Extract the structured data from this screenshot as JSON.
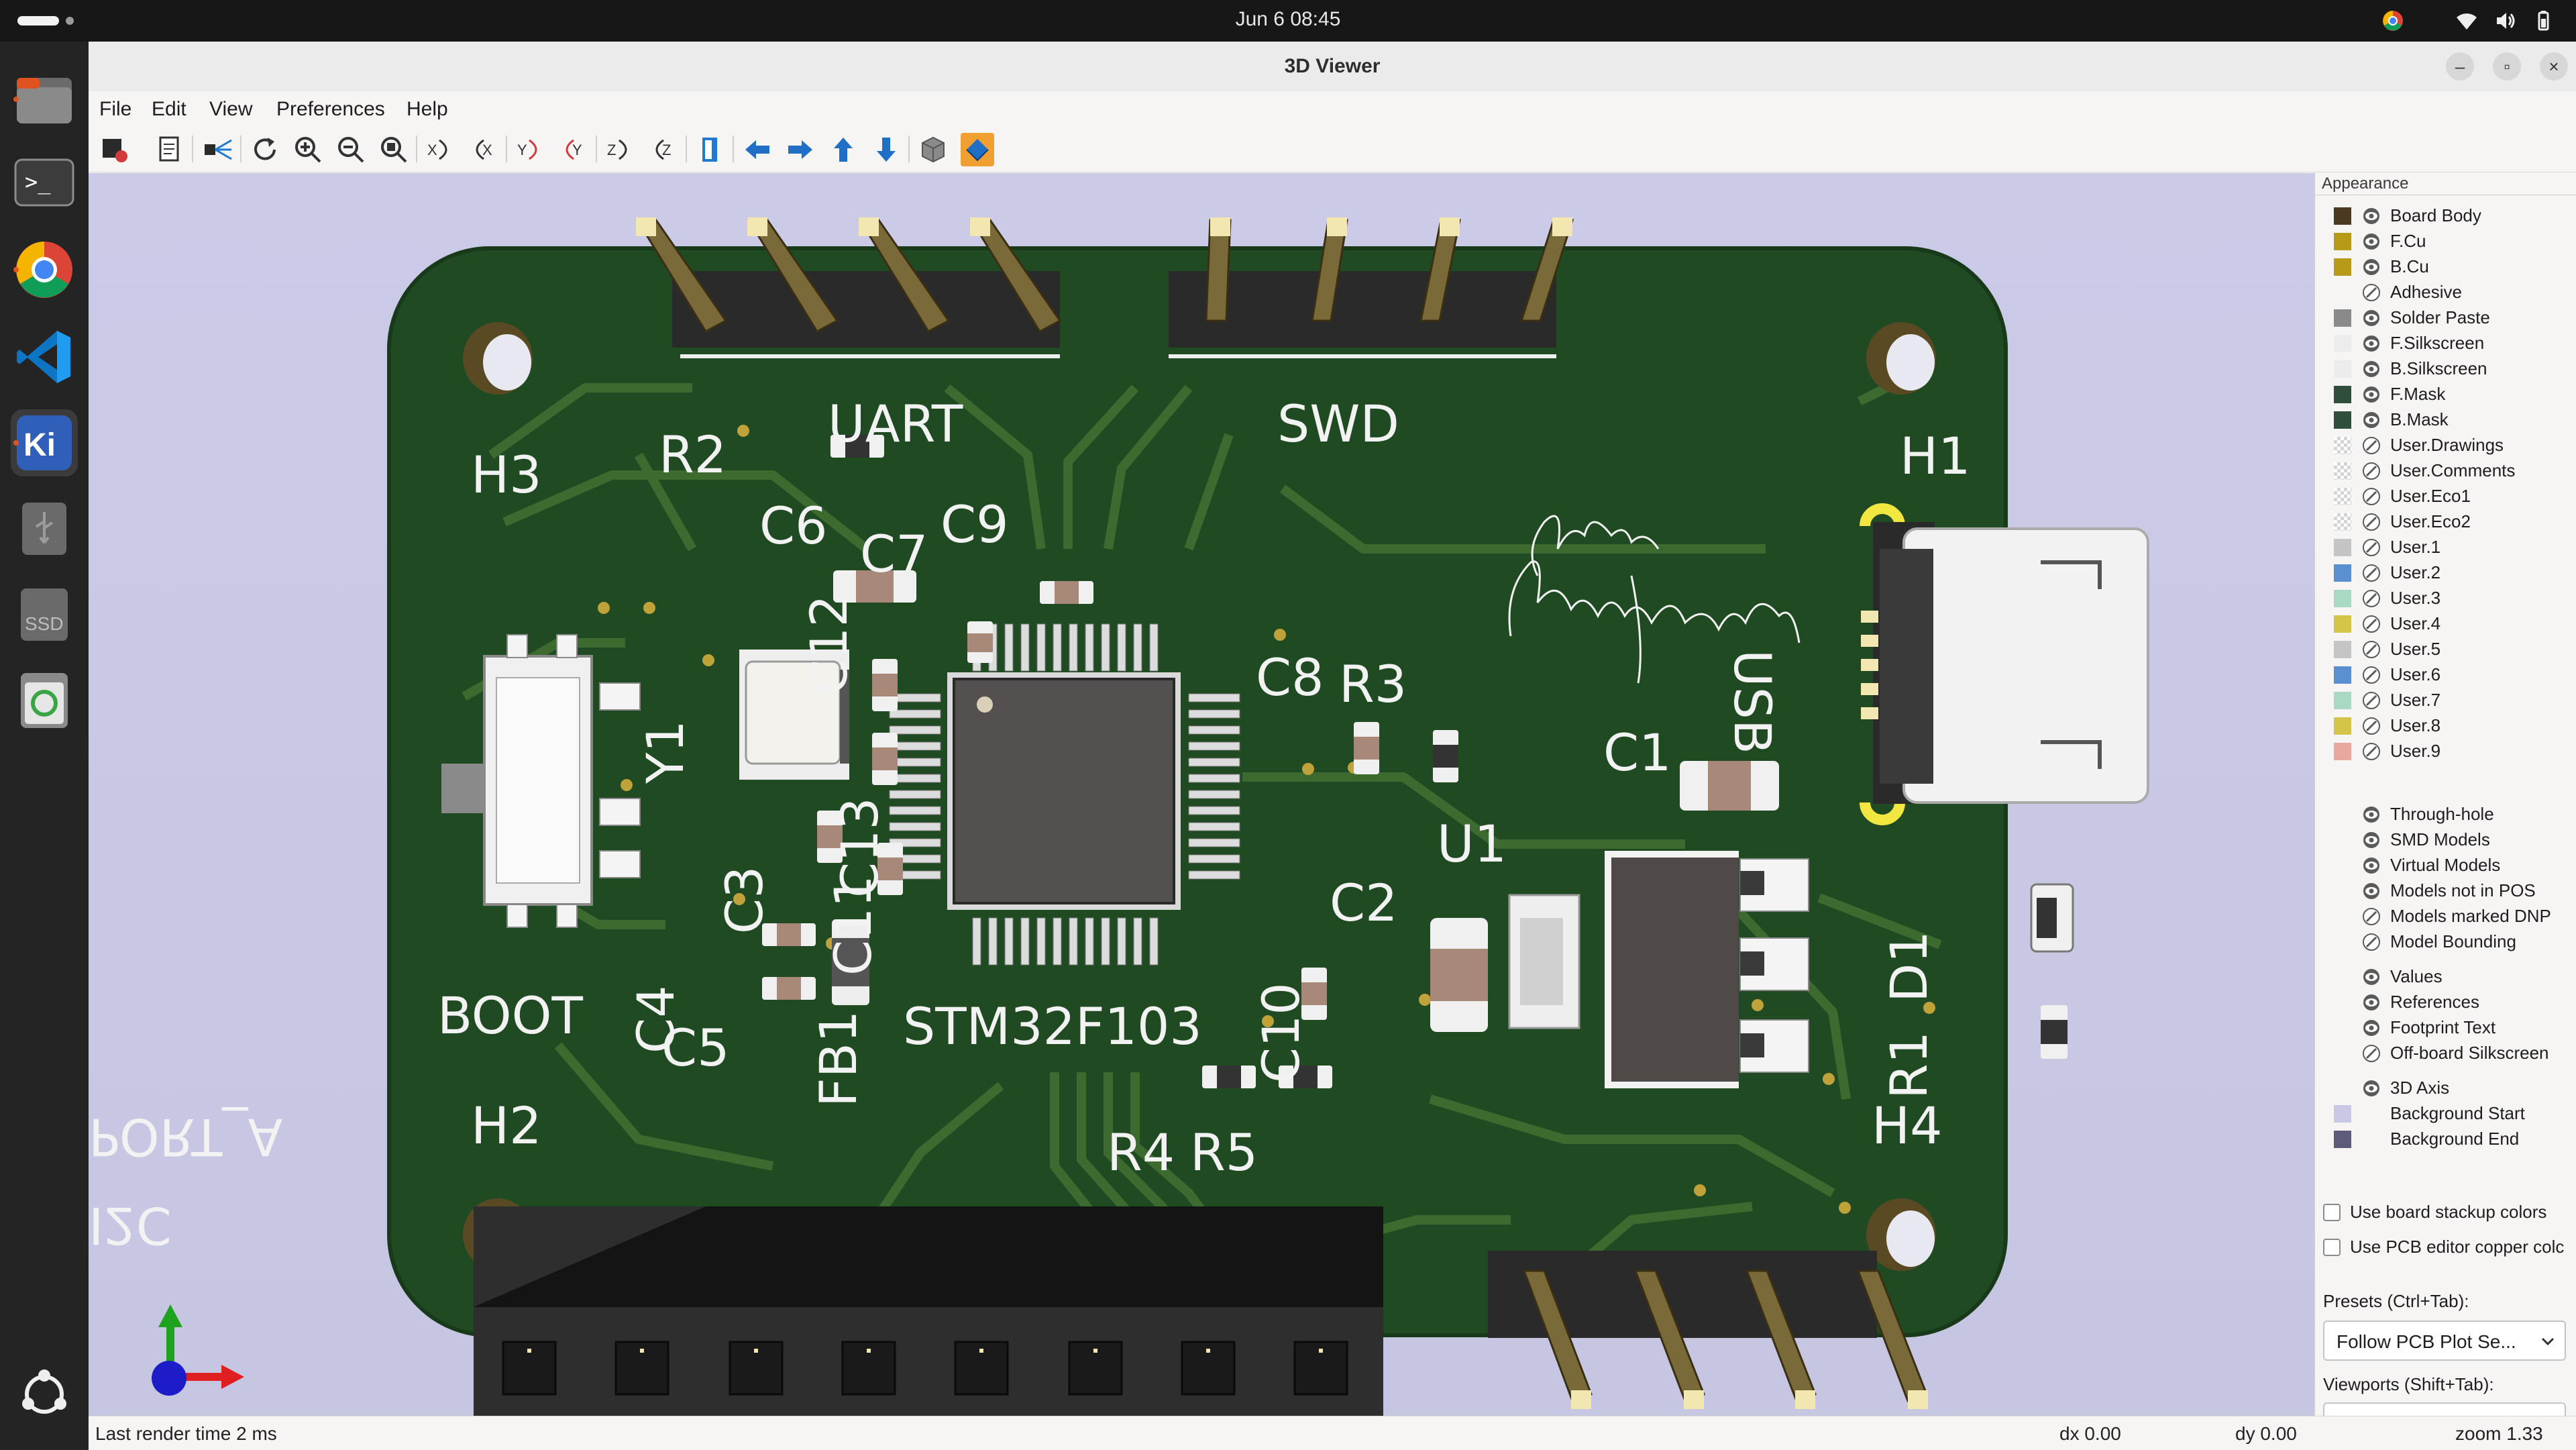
{
  "system": {
    "clock": "Jun 6  08:45"
  },
  "dock": {
    "items": [
      {
        "name": "Files",
        "icon": "folder-icon"
      },
      {
        "name": "Terminal",
        "icon": "terminal-icon"
      },
      {
        "name": "Google Chrome",
        "icon": "chrome-icon"
      },
      {
        "name": "Visual Studio Code",
        "icon": "vscode-icon"
      },
      {
        "name": "KiCad",
        "icon": "kicad-icon",
        "label": "Ki"
      },
      {
        "name": "USB Drive",
        "icon": "usb-icon"
      },
      {
        "name": "SSD",
        "icon": "drive-icon",
        "label": "SSD"
      },
      {
        "name": "Trash",
        "icon": "trash-icon"
      },
      {
        "name": "Show Apps",
        "icon": "ubuntu-icon"
      }
    ]
  },
  "window": {
    "title": "3D Viewer"
  },
  "menubar": [
    "File",
    "Edit",
    "View",
    "Preferences",
    "Help"
  ],
  "board": {
    "labels": {
      "uart": "UART",
      "swd": "SWD",
      "h1": "H1",
      "h2": "H2",
      "h3": "H3",
      "h4": "H4",
      "r1": "R1",
      "r2": "R2",
      "r3": "R3",
      "r4": "R4",
      "r5": "R5",
      "c1": "C1",
      "c2": "C2",
      "c3": "C3",
      "c4": "C4",
      "c5": "C5",
      "c6": "C6",
      "c7": "C7",
      "c8": "C8",
      "c9": "C9",
      "c10": "C10",
      "c11": "C11",
      "c12": "C12",
      "c13": "C13",
      "y1": "Y1",
      "fb1": "FB1",
      "u1": "U1",
      "d1": "D1",
      "usb": "USB",
      "boot": "BOOT",
      "mcu": "STM32F103",
      "porta": "PORT_A",
      "i2c": "I2C"
    },
    "colors": {
      "soldermask": "#1f4a22",
      "trace": "#3d6a2e",
      "silkscreen": "#f2f2f2",
      "background": "#c9cae6"
    }
  },
  "appearance": {
    "title": "Appearance",
    "layers": [
      {
        "name": "Board Body",
        "color": "#4a3a22",
        "visible": true
      },
      {
        "name": "F.Cu",
        "color": "#b89a1a",
        "visible": true
      },
      {
        "name": "B.Cu",
        "color": "#b89a1a",
        "visible": true
      },
      {
        "name": "Adhesive",
        "color": "",
        "visible": false
      },
      {
        "name": "Solder Paste",
        "color": "#8a8a8a",
        "visible": true
      },
      {
        "name": "F.Silkscreen",
        "color": "#ececec",
        "visible": true
      },
      {
        "name": "B.Silkscreen",
        "color": "#ececec",
        "visible": true
      },
      {
        "name": "F.Mask",
        "color": "#2f4f3a",
        "visible": true
      },
      {
        "name": "B.Mask",
        "color": "#2f4f3a",
        "visible": true
      },
      {
        "name": "User.Drawings",
        "color": "#e6e6e6",
        "visible": false
      },
      {
        "name": "User.Comments",
        "color": "#e6e6e6",
        "visible": false
      },
      {
        "name": "User.Eco1",
        "color": "#e6e6e6",
        "visible": false
      },
      {
        "name": "User.Eco2",
        "color": "#e6e6e6",
        "visible": false
      },
      {
        "name": "User.1",
        "color": "#c4c4c4",
        "visible": false
      },
      {
        "name": "User.2",
        "color": "#5a8fd0",
        "visible": false
      },
      {
        "name": "User.3",
        "color": "#a9d8c3",
        "visible": false
      },
      {
        "name": "User.4",
        "color": "#d4c44a",
        "visible": false
      },
      {
        "name": "User.5",
        "color": "#c4c4c4",
        "visible": false
      },
      {
        "name": "User.6",
        "color": "#5a8fd0",
        "visible": false
      },
      {
        "name": "User.7",
        "color": "#a9d8c3",
        "visible": false
      },
      {
        "name": "User.8",
        "color": "#d4c44a",
        "visible": false
      },
      {
        "name": "User.9",
        "color": "#e8a8a0",
        "visible": false
      }
    ],
    "objects": [
      {
        "name": "Through-hole",
        "visible": true
      },
      {
        "name": "SMD Models",
        "visible": true
      },
      {
        "name": "Virtual Models",
        "visible": true
      },
      {
        "name": "Models not in POS",
        "visible": true
      },
      {
        "name": "Models marked DNP",
        "visible": false
      },
      {
        "name": "Model Bounding",
        "visible": false
      },
      {
        "name": "Values",
        "visible": true
      },
      {
        "name": "References",
        "visible": true
      },
      {
        "name": "Footprint Text",
        "visible": true
      },
      {
        "name": "Off-board Silkscreen",
        "visible": false
      },
      {
        "name": "3D Axis",
        "visible": true
      },
      {
        "name": "Background Start",
        "color": "#c9c9e6"
      },
      {
        "name": "Background End",
        "color": "#5e5a7a"
      }
    ],
    "options": [
      {
        "label": "Use board stackup colors",
        "checked": false
      },
      {
        "label": "Use PCB editor copper colc",
        "checked": false
      }
    ],
    "presets_label": "Presets (Ctrl+Tab):",
    "presets_value": "Follow PCB Plot Se...",
    "viewports_label": "Viewports (Shift+Tab):",
    "viewports_value": "---"
  },
  "status": {
    "render_time": "Last render time 2 ms",
    "dx": "dx 0.00",
    "dy": "dy 0.00",
    "zoom": "zoom 1.33"
  }
}
